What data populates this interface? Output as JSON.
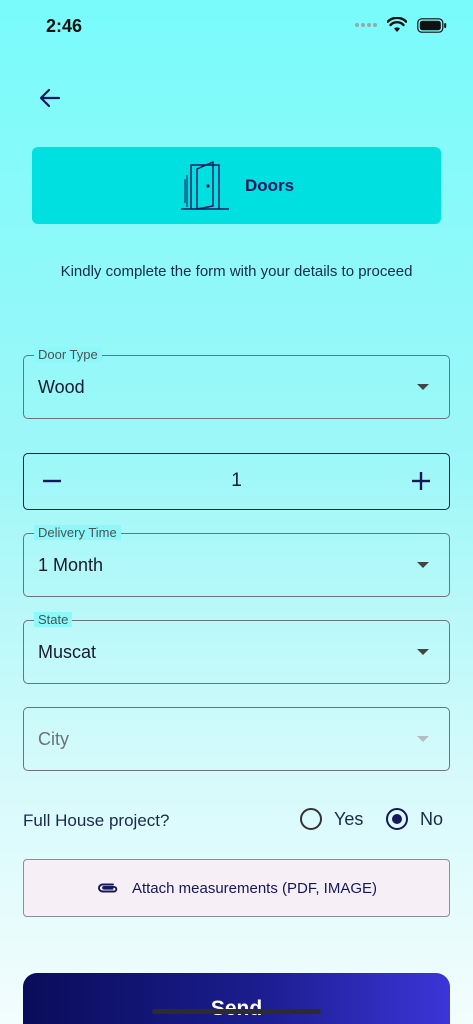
{
  "status_bar": {
    "time": "2:46"
  },
  "category": {
    "title": "Doors",
    "icon": "door-icon"
  },
  "instructions": "Kindly complete the form with your details to proceed",
  "form": {
    "door_type": {
      "label": "Door Type",
      "value": "Wood"
    },
    "quantity": {
      "value": "1"
    },
    "delivery_time": {
      "label": "Delivery Time",
      "value": "1 Month"
    },
    "state": {
      "label": "State",
      "value": "Muscat"
    },
    "city": {
      "placeholder": "City"
    },
    "full_house": {
      "question": "Full House project?",
      "yes_label": "Yes",
      "no_label": "No",
      "selected": "No"
    },
    "attach": {
      "label": "Attach measurements (PDF, IMAGE)",
      "icon": "paperclip-icon"
    },
    "send": {
      "label": "Send"
    }
  },
  "colors": {
    "accent": "#00e0e1",
    "primary": "#16175c"
  }
}
